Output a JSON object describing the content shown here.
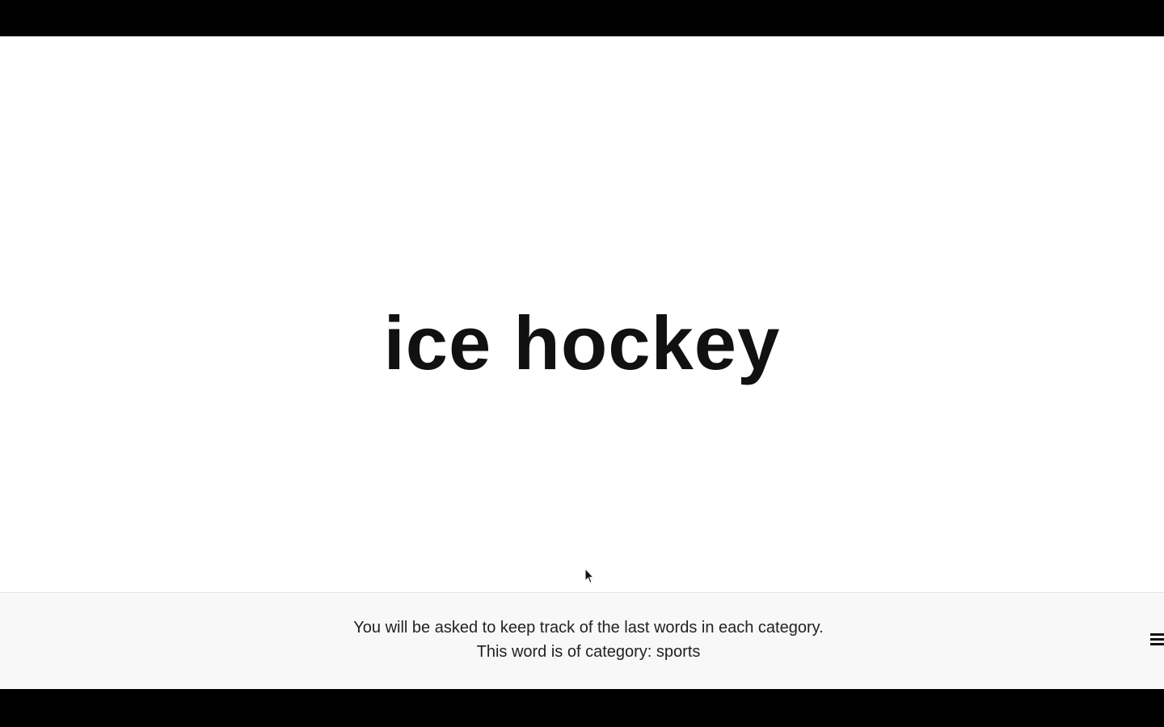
{
  "stimulus": {
    "word": "ice hockey"
  },
  "footer": {
    "instruction_line": "You will be asked to keep track of the last words in each category.",
    "category_line": "This word is of category: sports"
  },
  "icons": {
    "menu": "hamburger-menu-icon",
    "cursor": "mouse-pointer-icon"
  },
  "colors": {
    "letterbox": "#000000",
    "stage_background": "#ffffff",
    "footer_background": "#f8f8f8",
    "text": "#111111"
  }
}
